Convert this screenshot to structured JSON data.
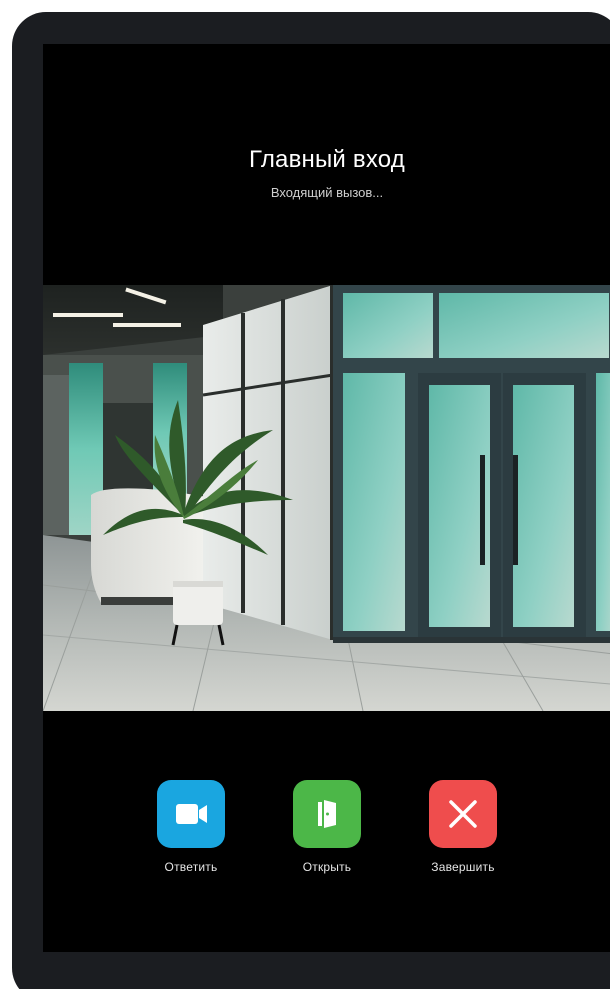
{
  "call": {
    "title": "Главный вход",
    "status": "Входящий вызов..."
  },
  "camera": {
    "feed": "lobby-camera-image"
  },
  "actions": {
    "answer": {
      "label": "Ответить",
      "icon": "video-camera-icon",
      "color": "#1aa6e0"
    },
    "open": {
      "label": "Открыть",
      "icon": "door-open-icon",
      "color": "#4cb748"
    },
    "end": {
      "label": "Завершить",
      "icon": "close-icon",
      "color": "#ef4d4d"
    }
  }
}
